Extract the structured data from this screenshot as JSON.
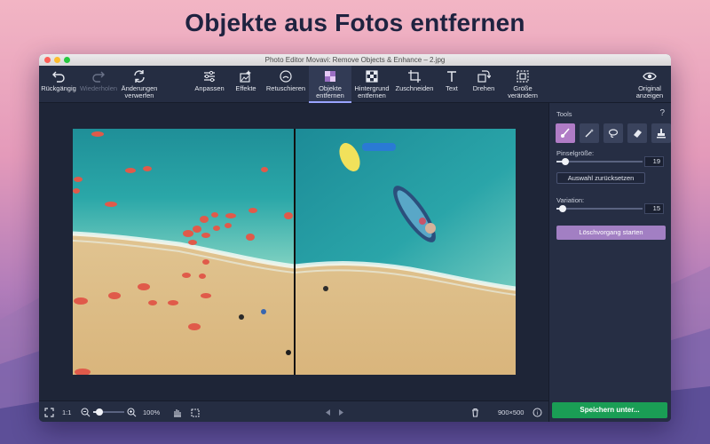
{
  "headline": "Objekte aus Fotos entfernen",
  "window": {
    "title": "Photo Editor Movavi: Remove Objects & Enhance – 2.jpg"
  },
  "toolbar": {
    "undo": "Rückgängig",
    "redo": "Wiederholen",
    "discard_line1": "Änderungen",
    "discard_line2": "verwerfen",
    "adjust": "Anpassen",
    "effects": "Effekte",
    "retouch": "Retuschieren",
    "remove_objects_line1": "Objekte",
    "remove_objects_line2": "entfernen",
    "bg_remove_line1": "Hintergrund",
    "bg_remove_line2": "entfernen",
    "crop": "Zuschneiden",
    "text": "Text",
    "rotate": "Drehen",
    "resize_line1": "Größe",
    "resize_line2": "verändern",
    "original_line1": "Original",
    "original_line2": "anzeigen"
  },
  "panel": {
    "tools_label": "Tools",
    "help": "?",
    "brush_size_label": "Pinselgröße:",
    "brush_size_value": "19",
    "brush_size_level": 0.1,
    "reset_selection": "Auswahl zurücksetzen",
    "variation_label": "Variation:",
    "variation_value": "15",
    "variation_level": 0.07,
    "start_erase": "Löschvorgang starten"
  },
  "statusbar": {
    "actual_size": "1:1",
    "zoom": "100%",
    "zoom_level": 0.2,
    "dimensions": "900×500",
    "info": "i"
  },
  "save_button": "Speichern unter...",
  "colors": {
    "accent": "#b07cc6",
    "save": "#1a9e55",
    "window_bg": "#1e2537",
    "toolbar_bg": "#252d42"
  },
  "icons": {
    "tools": [
      "brush-icon",
      "magic-wand-icon",
      "lasso-icon",
      "eraser-icon",
      "stamp-icon"
    ]
  }
}
